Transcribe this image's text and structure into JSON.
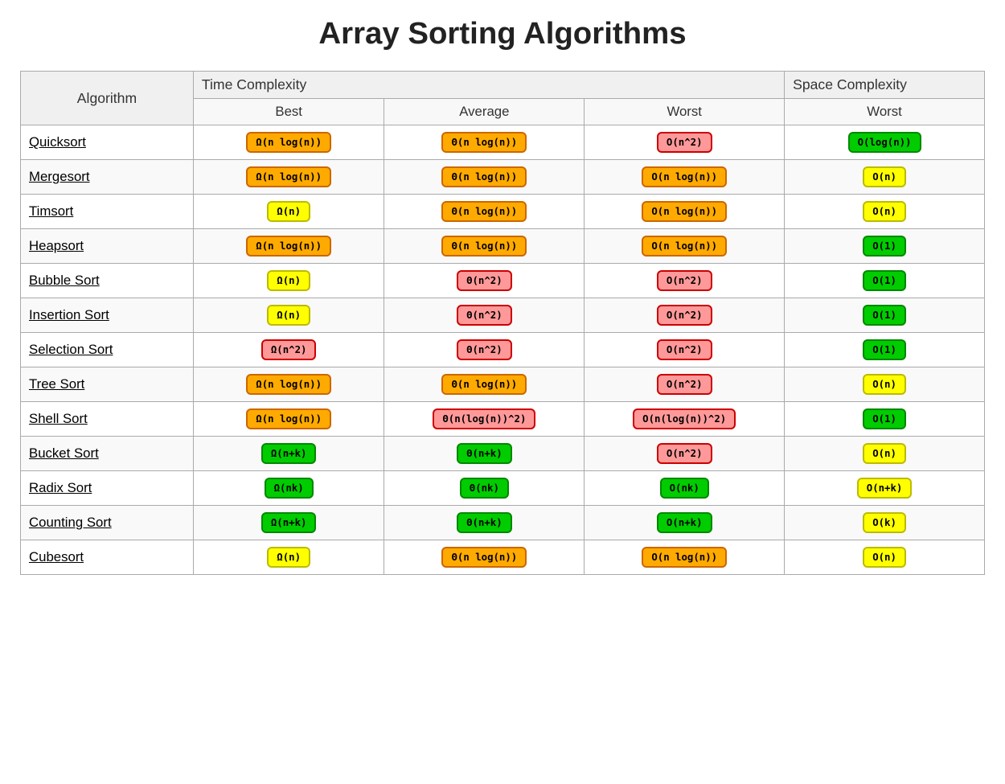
{
  "title": "Array Sorting Algorithms",
  "headers": {
    "col1": "Algorithm",
    "col2": "Time Complexity",
    "col3": "Space Complexity",
    "best": "Best",
    "average": "Average",
    "worst": "Worst",
    "space_worst": "Worst"
  },
  "rows": [
    {
      "name": "Quicksort",
      "best": {
        "text": "Ω(n log(n))",
        "color": "orange"
      },
      "average": {
        "text": "Θ(n log(n))",
        "color": "orange"
      },
      "worst": {
        "text": "O(n^2)",
        "color": "red"
      },
      "space": {
        "text": "O(log(n))",
        "color": "green"
      }
    },
    {
      "name": "Mergesort",
      "best": {
        "text": "Ω(n log(n))",
        "color": "orange"
      },
      "average": {
        "text": "Θ(n log(n))",
        "color": "orange"
      },
      "worst": {
        "text": "O(n log(n))",
        "color": "orange"
      },
      "space": {
        "text": "O(n)",
        "color": "yellow"
      }
    },
    {
      "name": "Timsort",
      "best": {
        "text": "Ω(n)",
        "color": "yellow"
      },
      "average": {
        "text": "Θ(n log(n))",
        "color": "orange"
      },
      "worst": {
        "text": "O(n log(n))",
        "color": "orange"
      },
      "space": {
        "text": "O(n)",
        "color": "yellow"
      }
    },
    {
      "name": "Heapsort",
      "best": {
        "text": "Ω(n log(n))",
        "color": "orange"
      },
      "average": {
        "text": "Θ(n log(n))",
        "color": "orange"
      },
      "worst": {
        "text": "O(n log(n))",
        "color": "orange"
      },
      "space": {
        "text": "O(1)",
        "color": "green"
      }
    },
    {
      "name": "Bubble Sort",
      "best": {
        "text": "Ω(n)",
        "color": "yellow"
      },
      "average": {
        "text": "Θ(n^2)",
        "color": "red"
      },
      "worst": {
        "text": "O(n^2)",
        "color": "red"
      },
      "space": {
        "text": "O(1)",
        "color": "green"
      }
    },
    {
      "name": "Insertion Sort",
      "best": {
        "text": "Ω(n)",
        "color": "yellow"
      },
      "average": {
        "text": "Θ(n^2)",
        "color": "red"
      },
      "worst": {
        "text": "O(n^2)",
        "color": "red"
      },
      "space": {
        "text": "O(1)",
        "color": "green"
      }
    },
    {
      "name": "Selection Sort",
      "best": {
        "text": "Ω(n^2)",
        "color": "red"
      },
      "average": {
        "text": "Θ(n^2)",
        "color": "red"
      },
      "worst": {
        "text": "O(n^2)",
        "color": "red"
      },
      "space": {
        "text": "O(1)",
        "color": "green"
      }
    },
    {
      "name": "Tree Sort",
      "best": {
        "text": "Ω(n log(n))",
        "color": "orange"
      },
      "average": {
        "text": "Θ(n log(n))",
        "color": "orange"
      },
      "worst": {
        "text": "O(n^2)",
        "color": "red"
      },
      "space": {
        "text": "O(n)",
        "color": "yellow"
      }
    },
    {
      "name": "Shell Sort",
      "best": {
        "text": "Ω(n log(n))",
        "color": "orange"
      },
      "average": {
        "text": "Θ(n(log(n))^2)",
        "color": "red"
      },
      "worst": {
        "text": "O(n(log(n))^2)",
        "color": "red"
      },
      "space": {
        "text": "O(1)",
        "color": "green"
      }
    },
    {
      "name": "Bucket Sort",
      "best": {
        "text": "Ω(n+k)",
        "color": "green"
      },
      "average": {
        "text": "Θ(n+k)",
        "color": "green"
      },
      "worst": {
        "text": "O(n^2)",
        "color": "red"
      },
      "space": {
        "text": "O(n)",
        "color": "yellow"
      }
    },
    {
      "name": "Radix Sort",
      "best": {
        "text": "Ω(nk)",
        "color": "green"
      },
      "average": {
        "text": "Θ(nk)",
        "color": "green"
      },
      "worst": {
        "text": "O(nk)",
        "color": "green"
      },
      "space": {
        "text": "O(n+k)",
        "color": "yellow"
      }
    },
    {
      "name": "Counting Sort",
      "best": {
        "text": "Ω(n+k)",
        "color": "green"
      },
      "average": {
        "text": "Θ(n+k)",
        "color": "green"
      },
      "worst": {
        "text": "O(n+k)",
        "color": "green"
      },
      "space": {
        "text": "O(k)",
        "color": "yellow"
      }
    },
    {
      "name": "Cubesort",
      "best": {
        "text": "Ω(n)",
        "color": "yellow"
      },
      "average": {
        "text": "Θ(n log(n))",
        "color": "orange"
      },
      "worst": {
        "text": "O(n log(n))",
        "color": "orange"
      },
      "space": {
        "text": "O(n)",
        "color": "yellow"
      }
    }
  ]
}
